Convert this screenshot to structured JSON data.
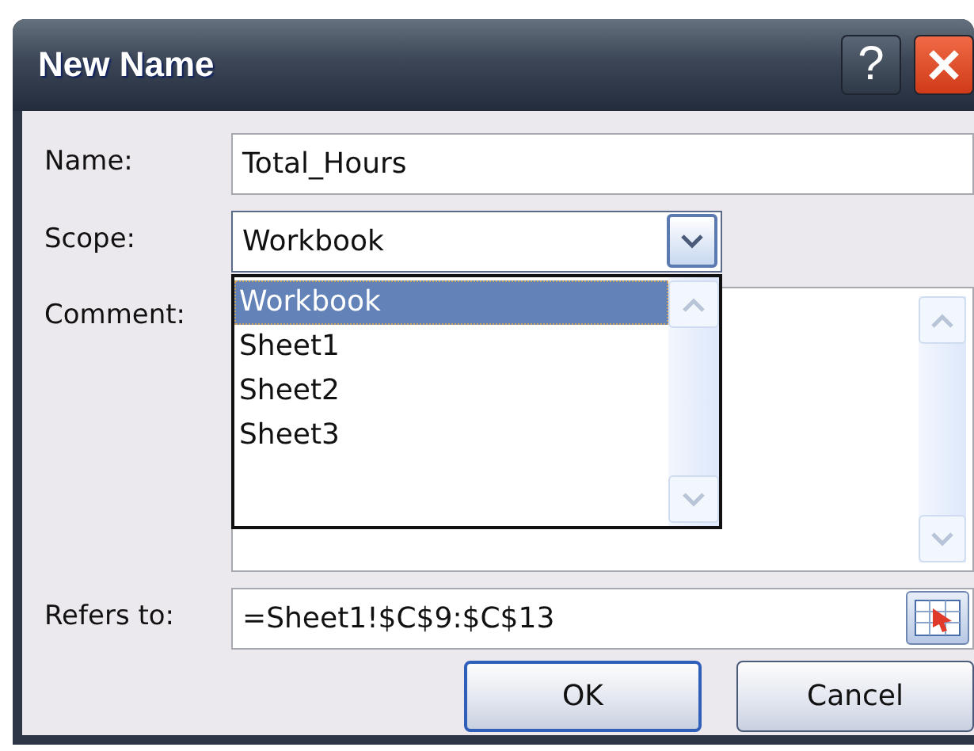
{
  "window": {
    "title": "New Name",
    "help_label": "?"
  },
  "name": {
    "label": "Name:",
    "value": "Total_Hours"
  },
  "scope": {
    "label": "Scope:",
    "value": "Workbook",
    "expanded": true,
    "options": [
      {
        "label": "Workbook",
        "selected": true
      },
      {
        "label": "Sheet1",
        "selected": false
      },
      {
        "label": "Sheet2",
        "selected": false
      },
      {
        "label": "Sheet3",
        "selected": false
      }
    ]
  },
  "comment": {
    "label": "Comment:"
  },
  "refers_to": {
    "label": "Refers to:",
    "value": "=Sheet1!$C$9:$C$13"
  },
  "buttons": [
    {
      "label": "OK",
      "default": true
    },
    {
      "label": "Cancel",
      "default": false
    }
  ]
}
